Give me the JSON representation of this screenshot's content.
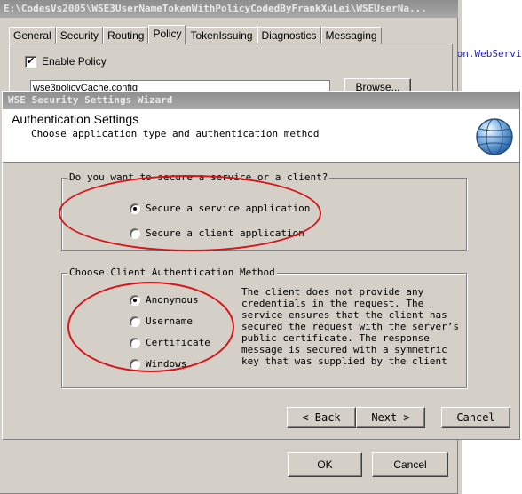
{
  "editor": {
    "code_snippet": "ion.WebServi"
  },
  "back_dialog": {
    "title": "E:\\CodesVs2005\\WSE3UserNameTokenWithPolicyCodedByFrankXuLei\\WSEUserNa...",
    "tabs": [
      "General",
      "Security",
      "Routing",
      "Policy",
      "TokenIssuing",
      "Diagnostics",
      "Messaging"
    ],
    "active_tab": "Policy",
    "enable_policy_label": "Enable Policy",
    "enable_policy_checked": true,
    "policy_cache_file": "wse3policyCache.config",
    "browse_label": "Browse...",
    "ok_label": "OK",
    "cancel_label": "Cancel"
  },
  "wizard": {
    "title": "WSE Security Settings Wizard",
    "heading": "Authentication Settings",
    "subheading": "Choose application type and authentication method",
    "secure_group": {
      "legend": "Do you want to secure a service or a client?",
      "options": [
        "Secure a service application",
        "Secure a client application"
      ],
      "selected": "Secure a service application"
    },
    "auth_group": {
      "legend": "Choose Client Authentication Method",
      "options": [
        "Anonymous",
        "Username",
        "Certificate",
        "Windows"
      ],
      "selected": "Anonymous",
      "description": "The client does not provide any credentials in the request. The service ensures that the client has secured the request with the server’s public certificate. The response message is secured with a symmetric key that was supplied by the client"
    },
    "buttons": {
      "back": "< Back",
      "next": "Next >",
      "cancel": "Cancel"
    },
    "highlight_color": "#d8141a",
    "icon": "globe-icon"
  }
}
